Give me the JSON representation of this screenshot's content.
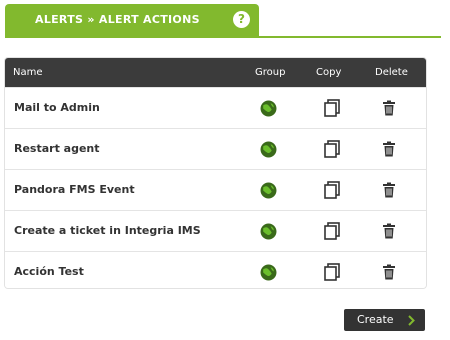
{
  "header": {
    "title": "ALERTS » ALERT ACTIONS",
    "help_icon": "help-icon"
  },
  "table": {
    "columns": {
      "name": "Name",
      "group": "Group",
      "copy": "Copy",
      "delete": "Delete"
    },
    "rows": [
      {
        "name": "Mail to Admin"
      },
      {
        "name": "Restart agent"
      },
      {
        "name": "Pandora FMS Event"
      },
      {
        "name": "Create a ticket in Integria IMS"
      },
      {
        "name": "Acción Test"
      }
    ]
  },
  "actions": {
    "create_label": "Create"
  },
  "colors": {
    "accent": "#82b92e",
    "header_bg": "#3b3b3b"
  }
}
